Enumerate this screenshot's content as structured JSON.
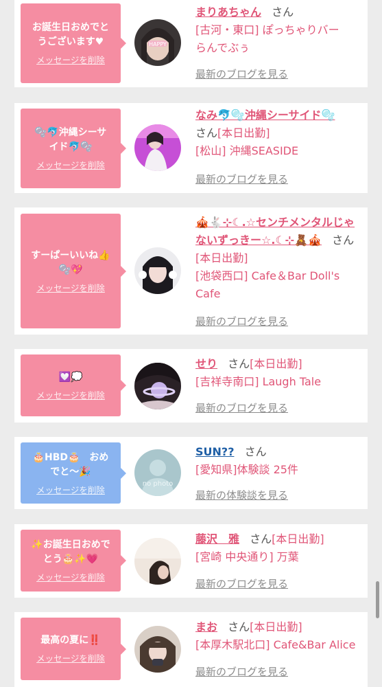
{
  "messages": [
    {
      "bubble_text": "お誕生日おめでと\nうございます♥",
      "bubble_color": "#f58da2",
      "delete_label": "メッセージを削除",
      "avatar_icon": "avatar-photo-icon",
      "name": "まりあちゃん",
      "name_color": "pink",
      "honorific": "さん",
      "status": "",
      "shop_lines": [
        "[古河・東口] ぽっちゃりバー",
        "らんでぶぅ"
      ],
      "more_link": "最新のブログを見る"
    },
    {
      "bubble_text": "🫧🐬沖縄シーサ\nイド🐬🫧",
      "bubble_color": "#f58da2",
      "delete_label": "メッセージを削除",
      "avatar_icon": "avatar-photo-icon",
      "name": "なみ🐬🫧沖縄シーサイド🫧",
      "name_color": "pink",
      "honorific": "さん",
      "status": "[本日出勤]",
      "shop_lines": [
        "[松山] 沖縄SEASIDE"
      ],
      "more_link": "最新のブログを見る"
    },
    {
      "bubble_text": "すーぱーいいね👍\n🫧💖",
      "bubble_color": "#f58da2",
      "delete_label": "メッセージを削除",
      "avatar_icon": "avatar-photo-icon",
      "name": "🎪🐇⊹☾.☆センチメンタルじゃないずっきー☆.☾⊹🧸🎪",
      "name_color": "pink",
      "honorific": "さん",
      "status": "[本日出勤]",
      "shop_lines": [
        "[池袋西口] Cafe＆Bar Doll's",
        "Cafe"
      ],
      "more_link": "最新のブログを見る"
    },
    {
      "bubble_text": "💟💭",
      "bubble_color": "#f58da2",
      "delete_label": "メッセージを削除",
      "avatar_icon": "avatar-photo-icon",
      "name": "せり",
      "name_color": "pink",
      "honorific": "さん",
      "status": "[本日出勤]",
      "shop_lines": [
        "[吉祥寺南口] Laugh Tale"
      ],
      "more_link": "最新のブログを見る"
    },
    {
      "bubble_text": "🎂HBD🎂　おめ\nでと〜🎉",
      "bubble_color": "#8ab4f0",
      "delete_label": "メッセージを削除",
      "avatar_icon": "no-photo-icon",
      "avatar_caption": "no photo",
      "name": "SUN??",
      "name_color": "blue",
      "honorific": "さん",
      "status": "",
      "shop_lines": [
        "[愛知県]体験談 25件"
      ],
      "more_link": "最新の体験談を見る"
    },
    {
      "bubble_text": "✨お誕生日おめで\nとう🎂✨💗",
      "bubble_color": "#f58da2",
      "delete_label": "メッセージを削除",
      "avatar_icon": "avatar-photo-icon",
      "name": "藤沢　雅",
      "name_color": "pink",
      "honorific": "さん",
      "status": "[本日出勤]",
      "shop_lines": [
        "[宮崎 中央通り] 万葉"
      ],
      "more_link": "最新のブログを見る"
    },
    {
      "bubble_text": "最高の夏に‼️",
      "bubble_color": "#f58da2",
      "delete_label": "メッセージを削除",
      "avatar_icon": "avatar-photo-icon",
      "name": "まお",
      "name_color": "pink",
      "honorific": "さん",
      "status": "[本日出勤]",
      "shop_lines": [
        "[本厚木駅北口] Cafe&Bar Alice"
      ],
      "more_link": "最新のブログを見る"
    }
  ]
}
